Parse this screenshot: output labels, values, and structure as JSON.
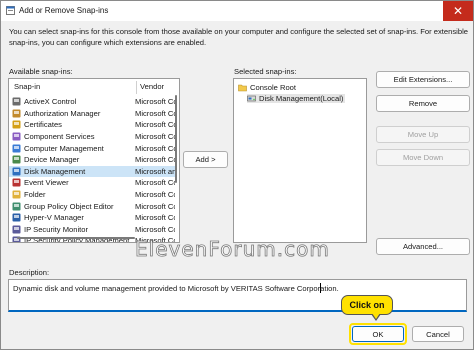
{
  "window": {
    "title": "Add or Remove Snap-ins",
    "intro": "You can select snap-ins for this console from those available on your computer and configure the selected set of snap-ins. For extensible snap-ins, you can configure which extensions are enabled."
  },
  "available": {
    "label": "Available snap-ins:",
    "col_name": "Snap-in",
    "col_vendor": "Vendor",
    "items": [
      {
        "name": "ActiveX Control",
        "vendor": "Microsoft Co",
        "icon": "activex-icon"
      },
      {
        "name": "Authorization Manager",
        "vendor": "Microsoft Co",
        "icon": "authorization-manager-icon"
      },
      {
        "name": "Certificates",
        "vendor": "Microsoft Co",
        "icon": "certificates-icon"
      },
      {
        "name": "Component Services",
        "vendor": "Microsoft Co",
        "icon": "component-services-icon"
      },
      {
        "name": "Computer Management",
        "vendor": "Microsoft Co",
        "icon": "computer-management-icon"
      },
      {
        "name": "Device Manager",
        "vendor": "Microsoft Co",
        "icon": "device-manager-icon"
      },
      {
        "name": "Disk Management",
        "vendor": "Microsoft an",
        "icon": "disk-management-icon"
      },
      {
        "name": "Event Viewer",
        "vendor": "Microsoft Co",
        "icon": "event-viewer-icon"
      },
      {
        "name": "Folder",
        "vendor": "Microsoft Co",
        "icon": "folder-icon"
      },
      {
        "name": "Group Policy Object Editor",
        "vendor": "Microsoft Co",
        "icon": "group-policy-icon"
      },
      {
        "name": "Hyper-V Manager",
        "vendor": "Microsoft Co",
        "icon": "hyper-v-icon"
      },
      {
        "name": "IP Security Monitor",
        "vendor": "Microsoft Co",
        "icon": "ip-security-monitor-icon"
      },
      {
        "name": "IP Security Policy Management",
        "vendor": "Microsoft Co",
        "icon": "ip-security-policy-icon"
      }
    ]
  },
  "add_button": "Add >",
  "selected": {
    "label": "Selected snap-ins:",
    "root": "Console Root",
    "child": "Disk Management(Local)"
  },
  "buttons": {
    "edit_extensions": "Edit Extensions...",
    "remove": "Remove",
    "move_up": "Move Up",
    "move_down": "Move Down",
    "advanced": "Advanced...",
    "ok": "OK",
    "cancel": "Cancel"
  },
  "description": {
    "label": "Description:",
    "text": "Dynamic disk and volume management provided to Microsoft by VERITAS Software Corporation."
  },
  "watermark": "ElevenForum.com",
  "callout": "Click on",
  "colors": {
    "accent": "#0067c0",
    "selection": "#cce4f7",
    "callout": "#ffe100",
    "close": "#c42b1c"
  }
}
